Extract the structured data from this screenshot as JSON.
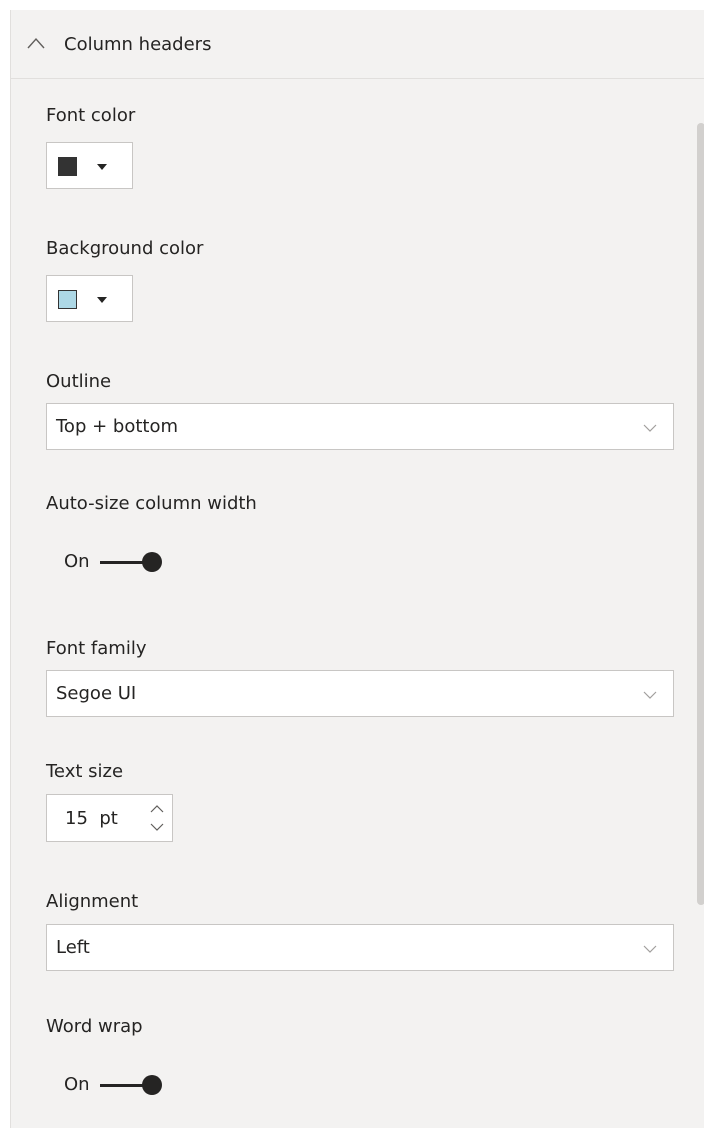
{
  "section": {
    "title": "Column headers",
    "expanded": true,
    "icon": "chevron-up-icon"
  },
  "font_color": {
    "label": "Font color",
    "swatch": "#333333"
  },
  "background_color": {
    "label": "Background color",
    "swatch": "#add8e6"
  },
  "outline": {
    "label": "Outline",
    "value": "Top + bottom"
  },
  "auto_size": {
    "label": "Auto-size column width",
    "state": "On"
  },
  "font_family": {
    "label": "Font family",
    "value": "Segoe UI"
  },
  "text_size": {
    "label": "Text size",
    "value": "15",
    "unit": "pt"
  },
  "alignment": {
    "label": "Alignment",
    "value": "Left"
  },
  "word_wrap": {
    "label": "Word wrap",
    "state": "On"
  },
  "colors": {
    "panel_bg": "#f3f2f1",
    "border": "#c8c6c4",
    "text": "#252423"
  }
}
